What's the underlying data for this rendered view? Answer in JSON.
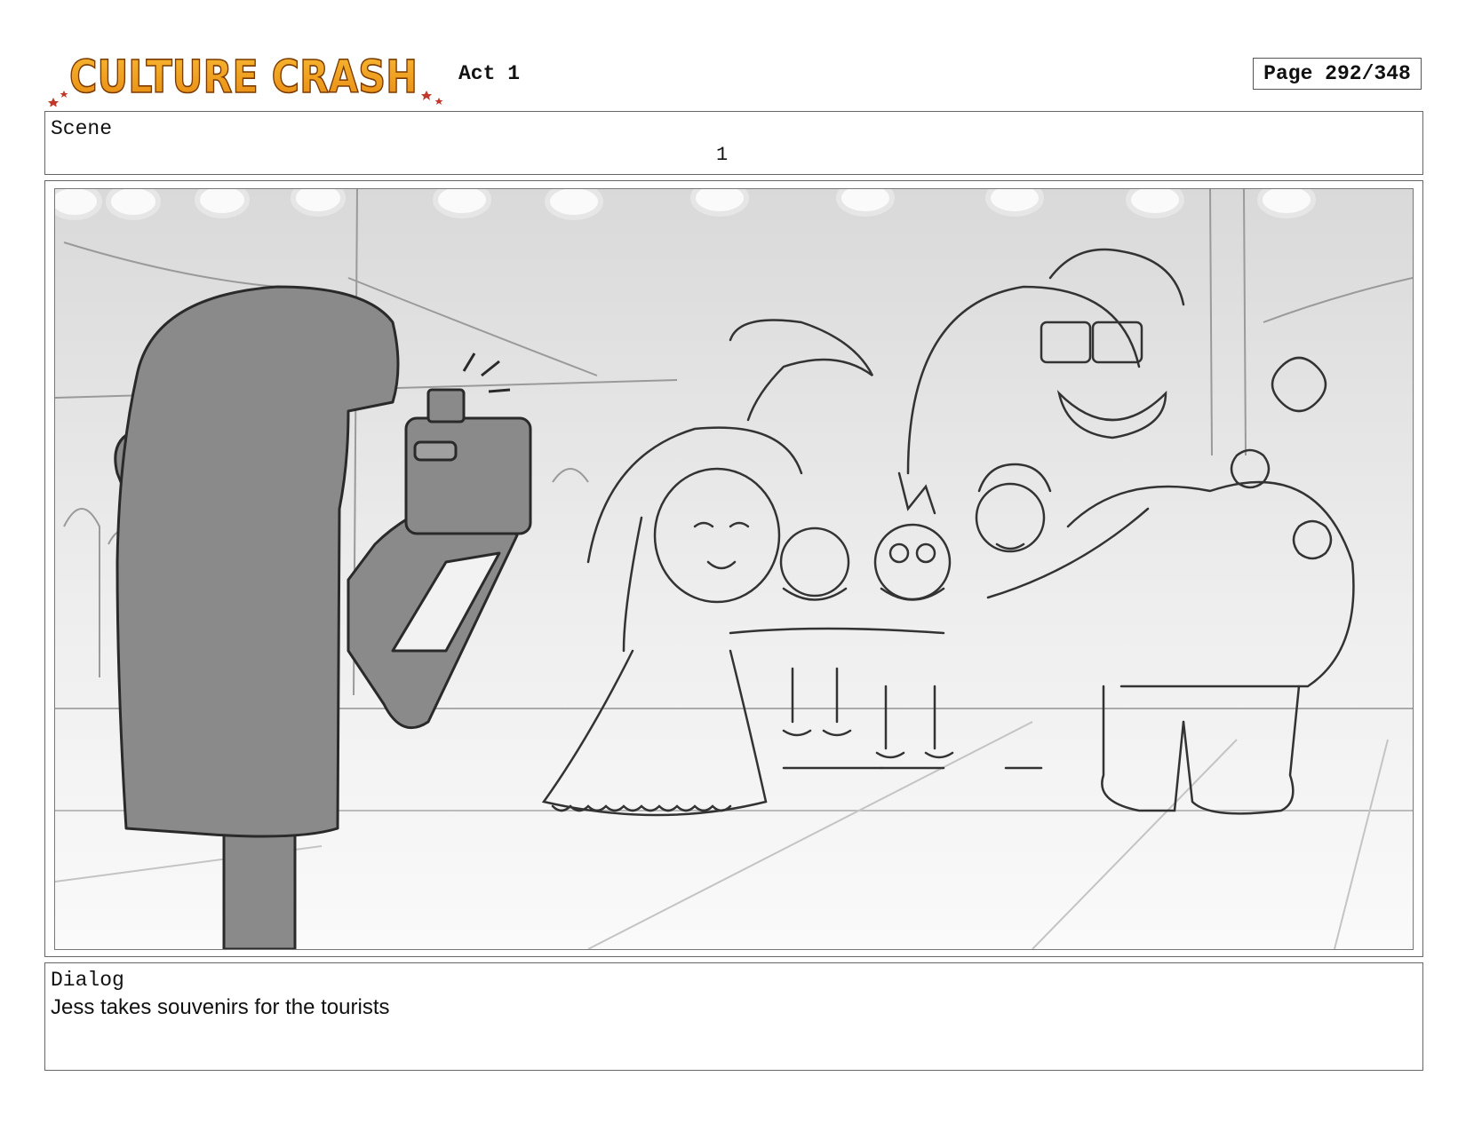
{
  "header": {
    "logo_text": "CULTURE CRASH",
    "act_label": "Act 1",
    "page_label": "Page 292/348"
  },
  "scene": {
    "label": "Scene",
    "number": "1"
  },
  "dialog": {
    "label": "Dialog",
    "text": "Jess takes souvenirs for the tourists"
  },
  "colors": {
    "logo_orange": "#F0A020",
    "logo_red": "#E24A1E",
    "silhouette_gray": "#8a8a8a",
    "sketch_line": "#333333"
  }
}
